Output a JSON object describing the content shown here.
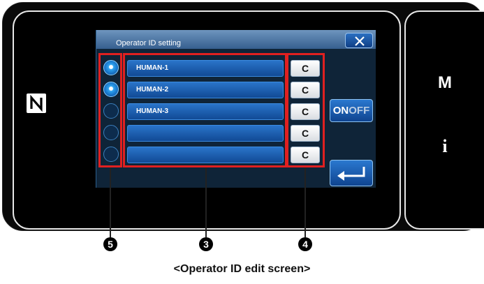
{
  "dialog": {
    "title": "Operator ID setting"
  },
  "operators": [
    {
      "name": "HUMAN-1",
      "selected": true
    },
    {
      "name": "HUMAN-2",
      "selected": true
    },
    {
      "name": "HUMAN-3",
      "selected": false
    },
    {
      "name": "",
      "selected": false
    },
    {
      "name": "",
      "selected": false
    }
  ],
  "clear_label": "C",
  "toggle": {
    "on": "ON",
    "off": "OFF"
  },
  "side": {
    "m_label": "M",
    "info_label": "i"
  },
  "callouts": {
    "radios": "5",
    "names": "3",
    "clear": "4"
  },
  "caption": "<Operator ID edit screen>",
  "colors": {
    "accent_blue": "#1a5fb4",
    "highlight_red": "#e02020"
  }
}
